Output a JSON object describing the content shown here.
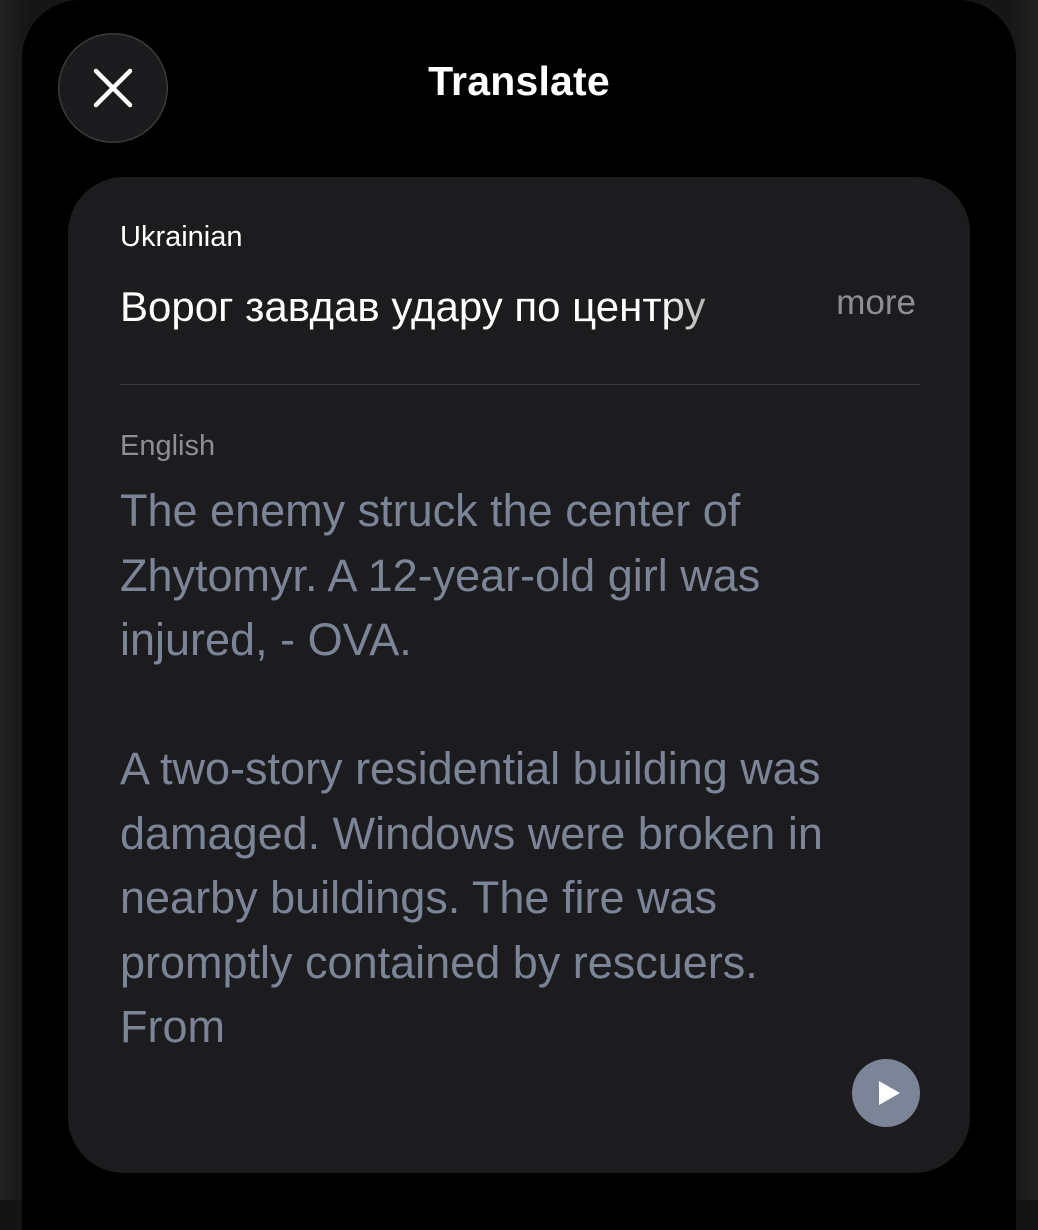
{
  "header": {
    "title": "Translate",
    "close_icon": "close-icon"
  },
  "source": {
    "language": "Ukrainian",
    "text": "Ворог завдав удару по центру",
    "more_label": "more"
  },
  "target": {
    "language": "English",
    "text": "The enemy struck the center of Zhytomyr. A 12-year-old girl was injured, - OVA.\n\nA two-story residential building was damaged. Windows were broken in nearby buildings. The fire was promptly contained by rescuers. From",
    "play_icon": "play-icon"
  },
  "colors": {
    "sheet": "#000000",
    "card": "#1c1c1e",
    "translated_text": "#7c8598",
    "secondary_text": "#8e8e93"
  }
}
